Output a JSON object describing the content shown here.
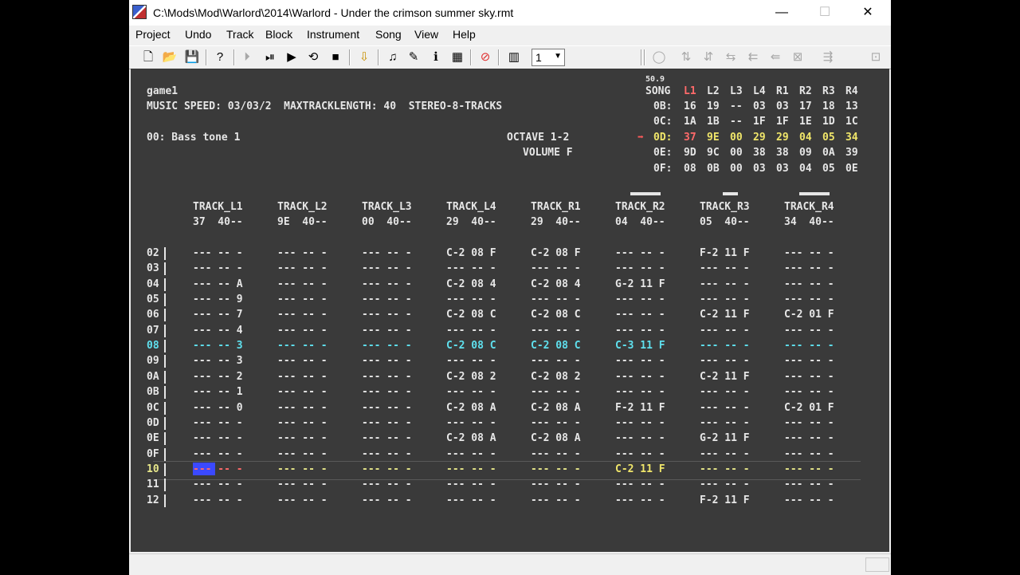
{
  "window": {
    "title": "C:\\Mods\\Mod\\Warlord\\2014\\Warlord - Under the crimson summer sky.rmt",
    "minimize": "—",
    "maximize": "☐",
    "close": "✕"
  },
  "menu": [
    "Project",
    "Undo",
    "Track",
    "Block",
    "Instrument",
    "Song",
    "View",
    "Help"
  ],
  "toolbar": {
    "octave_value": "1"
  },
  "info": {
    "song_name": "game1",
    "speed_line": "MUSIC SPEED: 03/03/2  MAXTRACKLENGTH: 40  STEREO-8-TRACKS",
    "instrument": "00: Bass tone 1",
    "octave": "OCTAVE 1-2",
    "volume": "VOLUME F",
    "fps": "50.9"
  },
  "song": {
    "header_label": "SONG",
    "columns": [
      "L1",
      "L2",
      "L3",
      "L4",
      "R1",
      "R2",
      "R3",
      "R4"
    ],
    "rows": [
      {
        "line": "0B:",
        "values": [
          "16",
          "19",
          "--",
          "03",
          "03",
          "17",
          "18",
          "13"
        ],
        "current": false
      },
      {
        "line": "0C:",
        "values": [
          "1A",
          "1B",
          "--",
          "1F",
          "1F",
          "1E",
          "1D",
          "1C"
        ],
        "current": false
      },
      {
        "line": "0D:",
        "values": [
          "37",
          "9E",
          "00",
          "29",
          "29",
          "04",
          "05",
          "34"
        ],
        "current": true
      },
      {
        "line": "0E:",
        "values": [
          "9D",
          "9C",
          "00",
          "38",
          "38",
          "09",
          "0A",
          "39"
        ],
        "current": false
      },
      {
        "line": "0F:",
        "values": [
          "08",
          "0B",
          "00",
          "03",
          "03",
          "04",
          "05",
          "0E"
        ],
        "current": false
      }
    ]
  },
  "tracks": [
    {
      "name": "TRACK_L1",
      "sub": "37  40--"
    },
    {
      "name": "TRACK_L2",
      "sub": "9E  40--"
    },
    {
      "name": "TRACK_L3",
      "sub": "00  40--"
    },
    {
      "name": "TRACK_L4",
      "sub": "29  40--"
    },
    {
      "name": "TRACK_R1",
      "sub": "29  40--"
    },
    {
      "name": "TRACK_R2",
      "sub": "04  40--"
    },
    {
      "name": "TRACK_R3",
      "sub": "05  40--"
    },
    {
      "name": "TRACK_R4",
      "sub": "34  40--"
    }
  ],
  "pattern": {
    "rows": [
      "02",
      "03",
      "04",
      "05",
      "06",
      "07",
      "08",
      "09",
      "0A",
      "0B",
      "0C",
      "0D",
      "0E",
      "0F",
      "10",
      "11",
      "12"
    ],
    "highlight_row": "08",
    "cursor_row": "10",
    "cells": [
      [
        "--- -- -",
        "--- -- -",
        "--- -- -",
        "C-2 08 F",
        "C-2 08 F",
        "--- -- -",
        "F-2 11 F",
        "--- -- -"
      ],
      [
        "--- -- -",
        "--- -- -",
        "--- -- -",
        "--- -- -",
        "--- -- -",
        "--- -- -",
        "--- -- -",
        "--- -- -"
      ],
      [
        "--- -- A",
        "--- -- -",
        "--- -- -",
        "C-2 08 4",
        "C-2 08 4",
        "G-2 11 F",
        "--- -- -",
        "--- -- -"
      ],
      [
        "--- -- 9",
        "--- -- -",
        "--- -- -",
        "--- -- -",
        "--- -- -",
        "--- -- -",
        "--- -- -",
        "--- -- -"
      ],
      [
        "--- -- 7",
        "--- -- -",
        "--- -- -",
        "C-2 08 C",
        "C-2 08 C",
        "--- -- -",
        "C-2 11 F",
        "C-2 01 F"
      ],
      [
        "--- -- 4",
        "--- -- -",
        "--- -- -",
        "--- -- -",
        "--- -- -",
        "--- -- -",
        "--- -- -",
        "--- -- -"
      ],
      [
        "--- -- 3",
        "--- -- -",
        "--- -- -",
        "C-2 08 C",
        "C-2 08 C",
        "C-3 11 F",
        "--- -- -",
        "--- -- -"
      ],
      [
        "--- -- 3",
        "--- -- -",
        "--- -- -",
        "--- -- -",
        "--- -- -",
        "--- -- -",
        "--- -- -",
        "--- -- -"
      ],
      [
        "--- -- 2",
        "--- -- -",
        "--- -- -",
        "C-2 08 2",
        "C-2 08 2",
        "--- -- -",
        "C-2 11 F",
        "--- -- -"
      ],
      [
        "--- -- 1",
        "--- -- -",
        "--- -- -",
        "--- -- -",
        "--- -- -",
        "--- -- -",
        "--- -- -",
        "--- -- -"
      ],
      [
        "--- -- 0",
        "--- -- -",
        "--- -- -",
        "C-2 08 A",
        "C-2 08 A",
        "F-2 11 F",
        "--- -- -",
        "C-2 01 F"
      ],
      [
        "--- -- -",
        "--- -- -",
        "--- -- -",
        "--- -- -",
        "--- -- -",
        "--- -- -",
        "--- -- -",
        "--- -- -"
      ],
      [
        "--- -- -",
        "--- -- -",
        "--- -- -",
        "C-2 08 A",
        "C-2 08 A",
        "--- -- -",
        "G-2 11 F",
        "--- -- -"
      ],
      [
        "--- -- -",
        "--- -- -",
        "--- -- -",
        "--- -- -",
        "--- -- -",
        "--- -- -",
        "--- -- -",
        "--- -- -"
      ],
      [
        "--- -- -",
        "--- -- -",
        "--- -- -",
        "--- -- -",
        "--- -- -",
        "C-2 11 F",
        "--- -- -",
        "--- -- -"
      ],
      [
        "--- -- -",
        "--- -- -",
        "--- -- -",
        "--- -- -",
        "--- -- -",
        "--- -- -",
        "--- -- -",
        "--- -- -"
      ],
      [
        "--- -- -",
        "--- -- -",
        "--- -- -",
        "--- -- -",
        "--- -- -",
        "--- -- -",
        "F-2 11 F",
        "--- -- -"
      ]
    ]
  },
  "vu_levels": [
    0,
    0,
    0,
    0,
    0,
    0.5,
    0.25,
    0.5
  ],
  "colors": {
    "text": "#e6e6e6",
    "highlight_row": "#5fe0ee",
    "current_song_line": "#f0e66a",
    "active_column": "#ff6a6a",
    "play_arrow": "#ff5a5a",
    "cursor_empty_rest": "#ff6a6a",
    "cursor_row_empty": "#e6e68a",
    "editor_bg": "#3a3a3a"
  }
}
